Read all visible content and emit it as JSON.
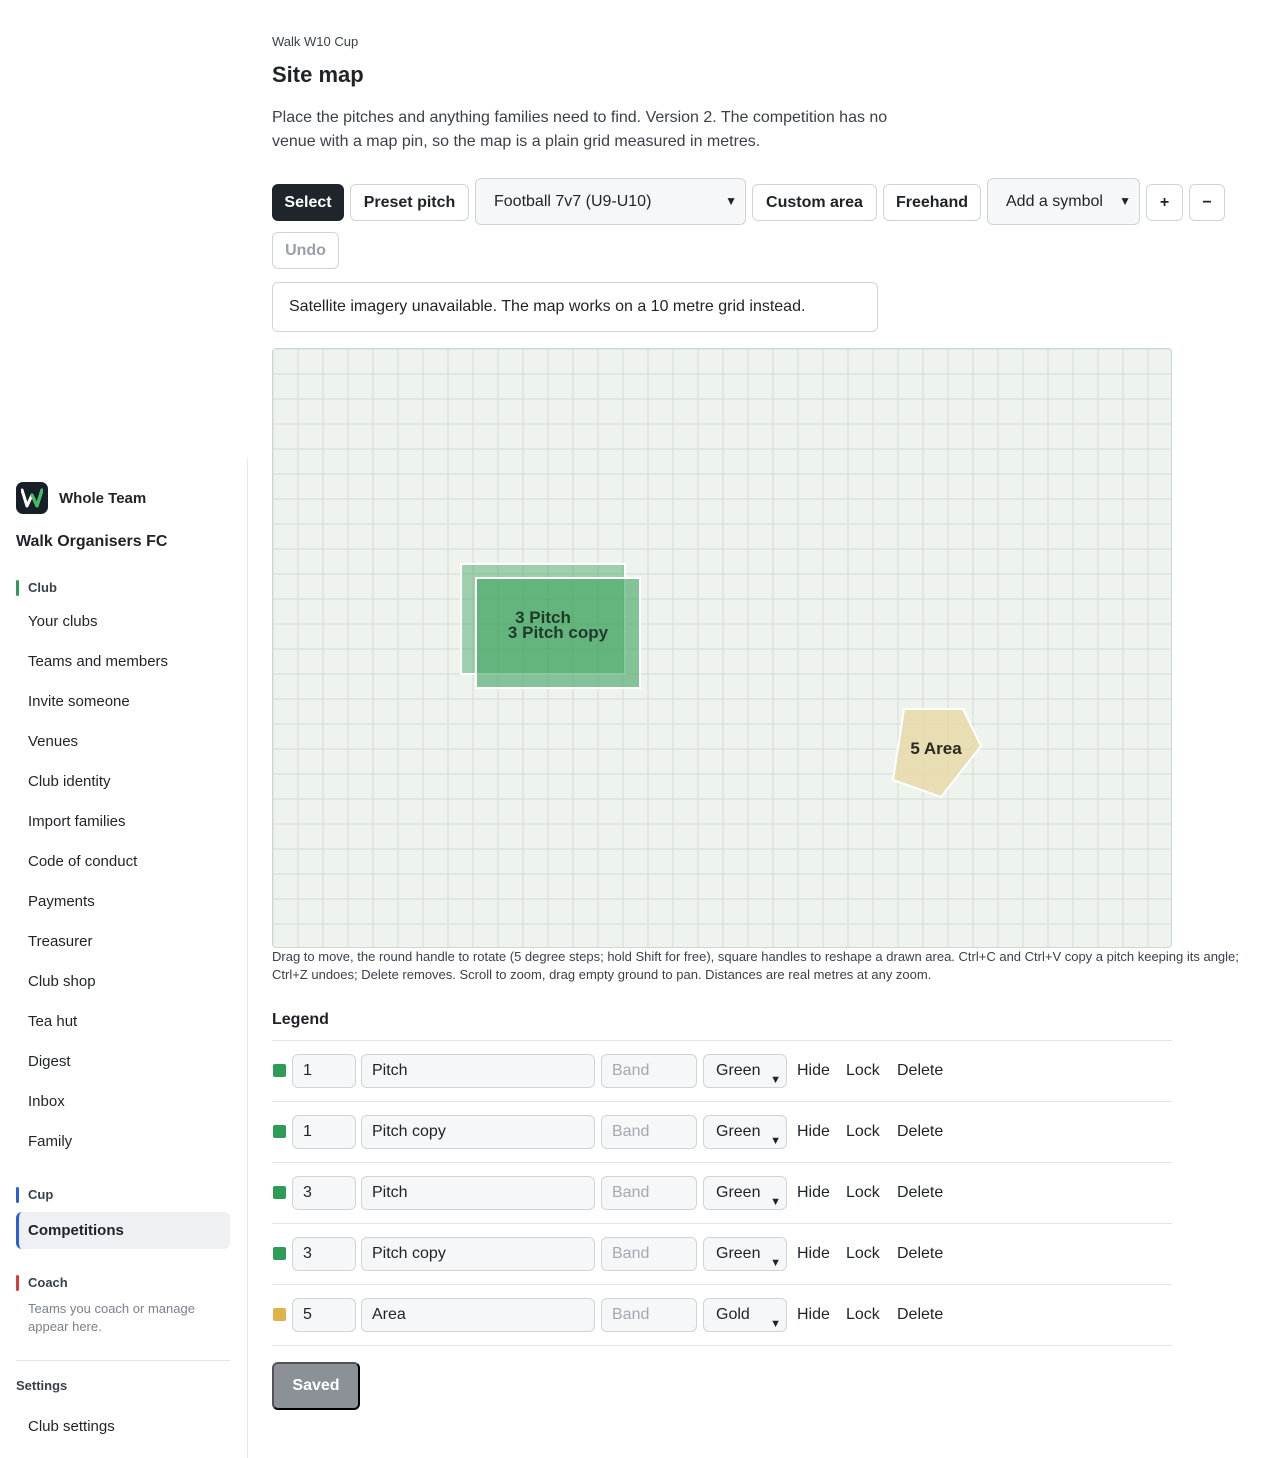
{
  "sidebar": {
    "brand": "Whole Team",
    "club": "Walk Organisers FC",
    "club_section": "Club",
    "club_items": [
      "Your clubs",
      "Teams and members",
      "Invite someone",
      "Venues",
      "Club identity",
      "Import families",
      "Code of conduct",
      "Payments",
      "Treasurer",
      "Club shop",
      "Tea hut",
      "Digest",
      "Inbox",
      "Family"
    ],
    "cup_section": "Cup",
    "cup_active": "Competitions",
    "coach_section": "Coach",
    "coach_note": "Teams you coach or manage appear here.",
    "settings_section": "Settings",
    "settings_item": "Club settings",
    "section_colors": {
      "club": "#2e9b57",
      "cup": "#2b5fd9",
      "coach": "#d93a3a"
    }
  },
  "main": {
    "breadcrumb": "Walk W10 Cup",
    "title": "Site map",
    "lede": "Place the pitches and anything families need to find. Version 2. The competition has no venue with a map pin, so the map is a plain grid measured in metres.",
    "toolbar": {
      "select": "Select",
      "preset_pitch": "Preset pitch",
      "preset_value": "Football 7v7 (U9-U10)",
      "custom_area": "Custom area",
      "freehand": "Freehand",
      "symbol_value": "Add a symbol",
      "zoom_in": "+",
      "zoom_out": "−",
      "undo": "Undo"
    },
    "notice": "Satellite imagery unavailable. The map works on a 10 metre grid instead.",
    "map_labels": {
      "pitch": "3 Pitch",
      "pitch_copy": "3 Pitch copy",
      "area": "5 Area"
    },
    "help": "Drag to move, the round handle to rotate (5 degree steps; hold Shift for free), square handles to reshape a drawn area. Ctrl+C and Ctrl+V copy a pitch keeping its angle; Ctrl+Z undoes; Delete removes. Scroll to zoom, drag empty ground to pan. Distances are real metres at any zoom."
  },
  "legend": {
    "title": "Legend",
    "band_placeholder": "Band",
    "actions": {
      "hide": "Hide",
      "lock": "Lock",
      "delete": "Delete"
    },
    "rows": [
      {
        "number": "1",
        "name": "Pitch",
        "color": "Green",
        "swatch": "#2e9b57"
      },
      {
        "number": "1",
        "name": "Pitch copy",
        "color": "Green",
        "swatch": "#2e9b57"
      },
      {
        "number": "3",
        "name": "Pitch",
        "color": "Green",
        "swatch": "#2e9b57"
      },
      {
        "number": "3",
        "name": "Pitch copy",
        "color": "Green",
        "swatch": "#2e9b57"
      },
      {
        "number": "5",
        "name": "Area",
        "color": "Gold",
        "swatch": "#e0b24a"
      }
    ],
    "saved": "Saved"
  }
}
